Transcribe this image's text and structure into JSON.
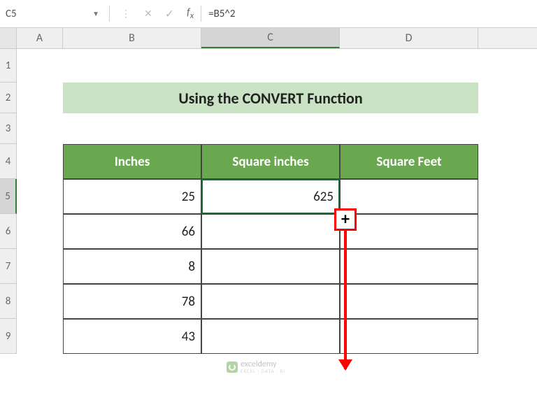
{
  "formula_bar": {
    "name_box": "C5",
    "formula": "=B5^2"
  },
  "columns": [
    "A",
    "B",
    "C",
    "D"
  ],
  "rows": [
    "1",
    "2",
    "3",
    "4",
    "5",
    "6",
    "7",
    "8",
    "9"
  ],
  "selected_cell": "C5",
  "title_banner": "Using the CONVERT Function",
  "table": {
    "headers": [
      "Inches",
      "Square inches",
      "Square Feet"
    ],
    "rows": [
      {
        "inches": "25",
        "sq_in": "625",
        "sq_ft": ""
      },
      {
        "inches": "66",
        "sq_in": "",
        "sq_ft": ""
      },
      {
        "inches": "8",
        "sq_in": "",
        "sq_ft": ""
      },
      {
        "inches": "78",
        "sq_in": "",
        "sq_ft": ""
      },
      {
        "inches": "43",
        "sq_in": "",
        "sq_ft": ""
      }
    ]
  },
  "watermark": {
    "brand": "exceldemy",
    "tagline": "EXCEL · DATA · BI"
  }
}
